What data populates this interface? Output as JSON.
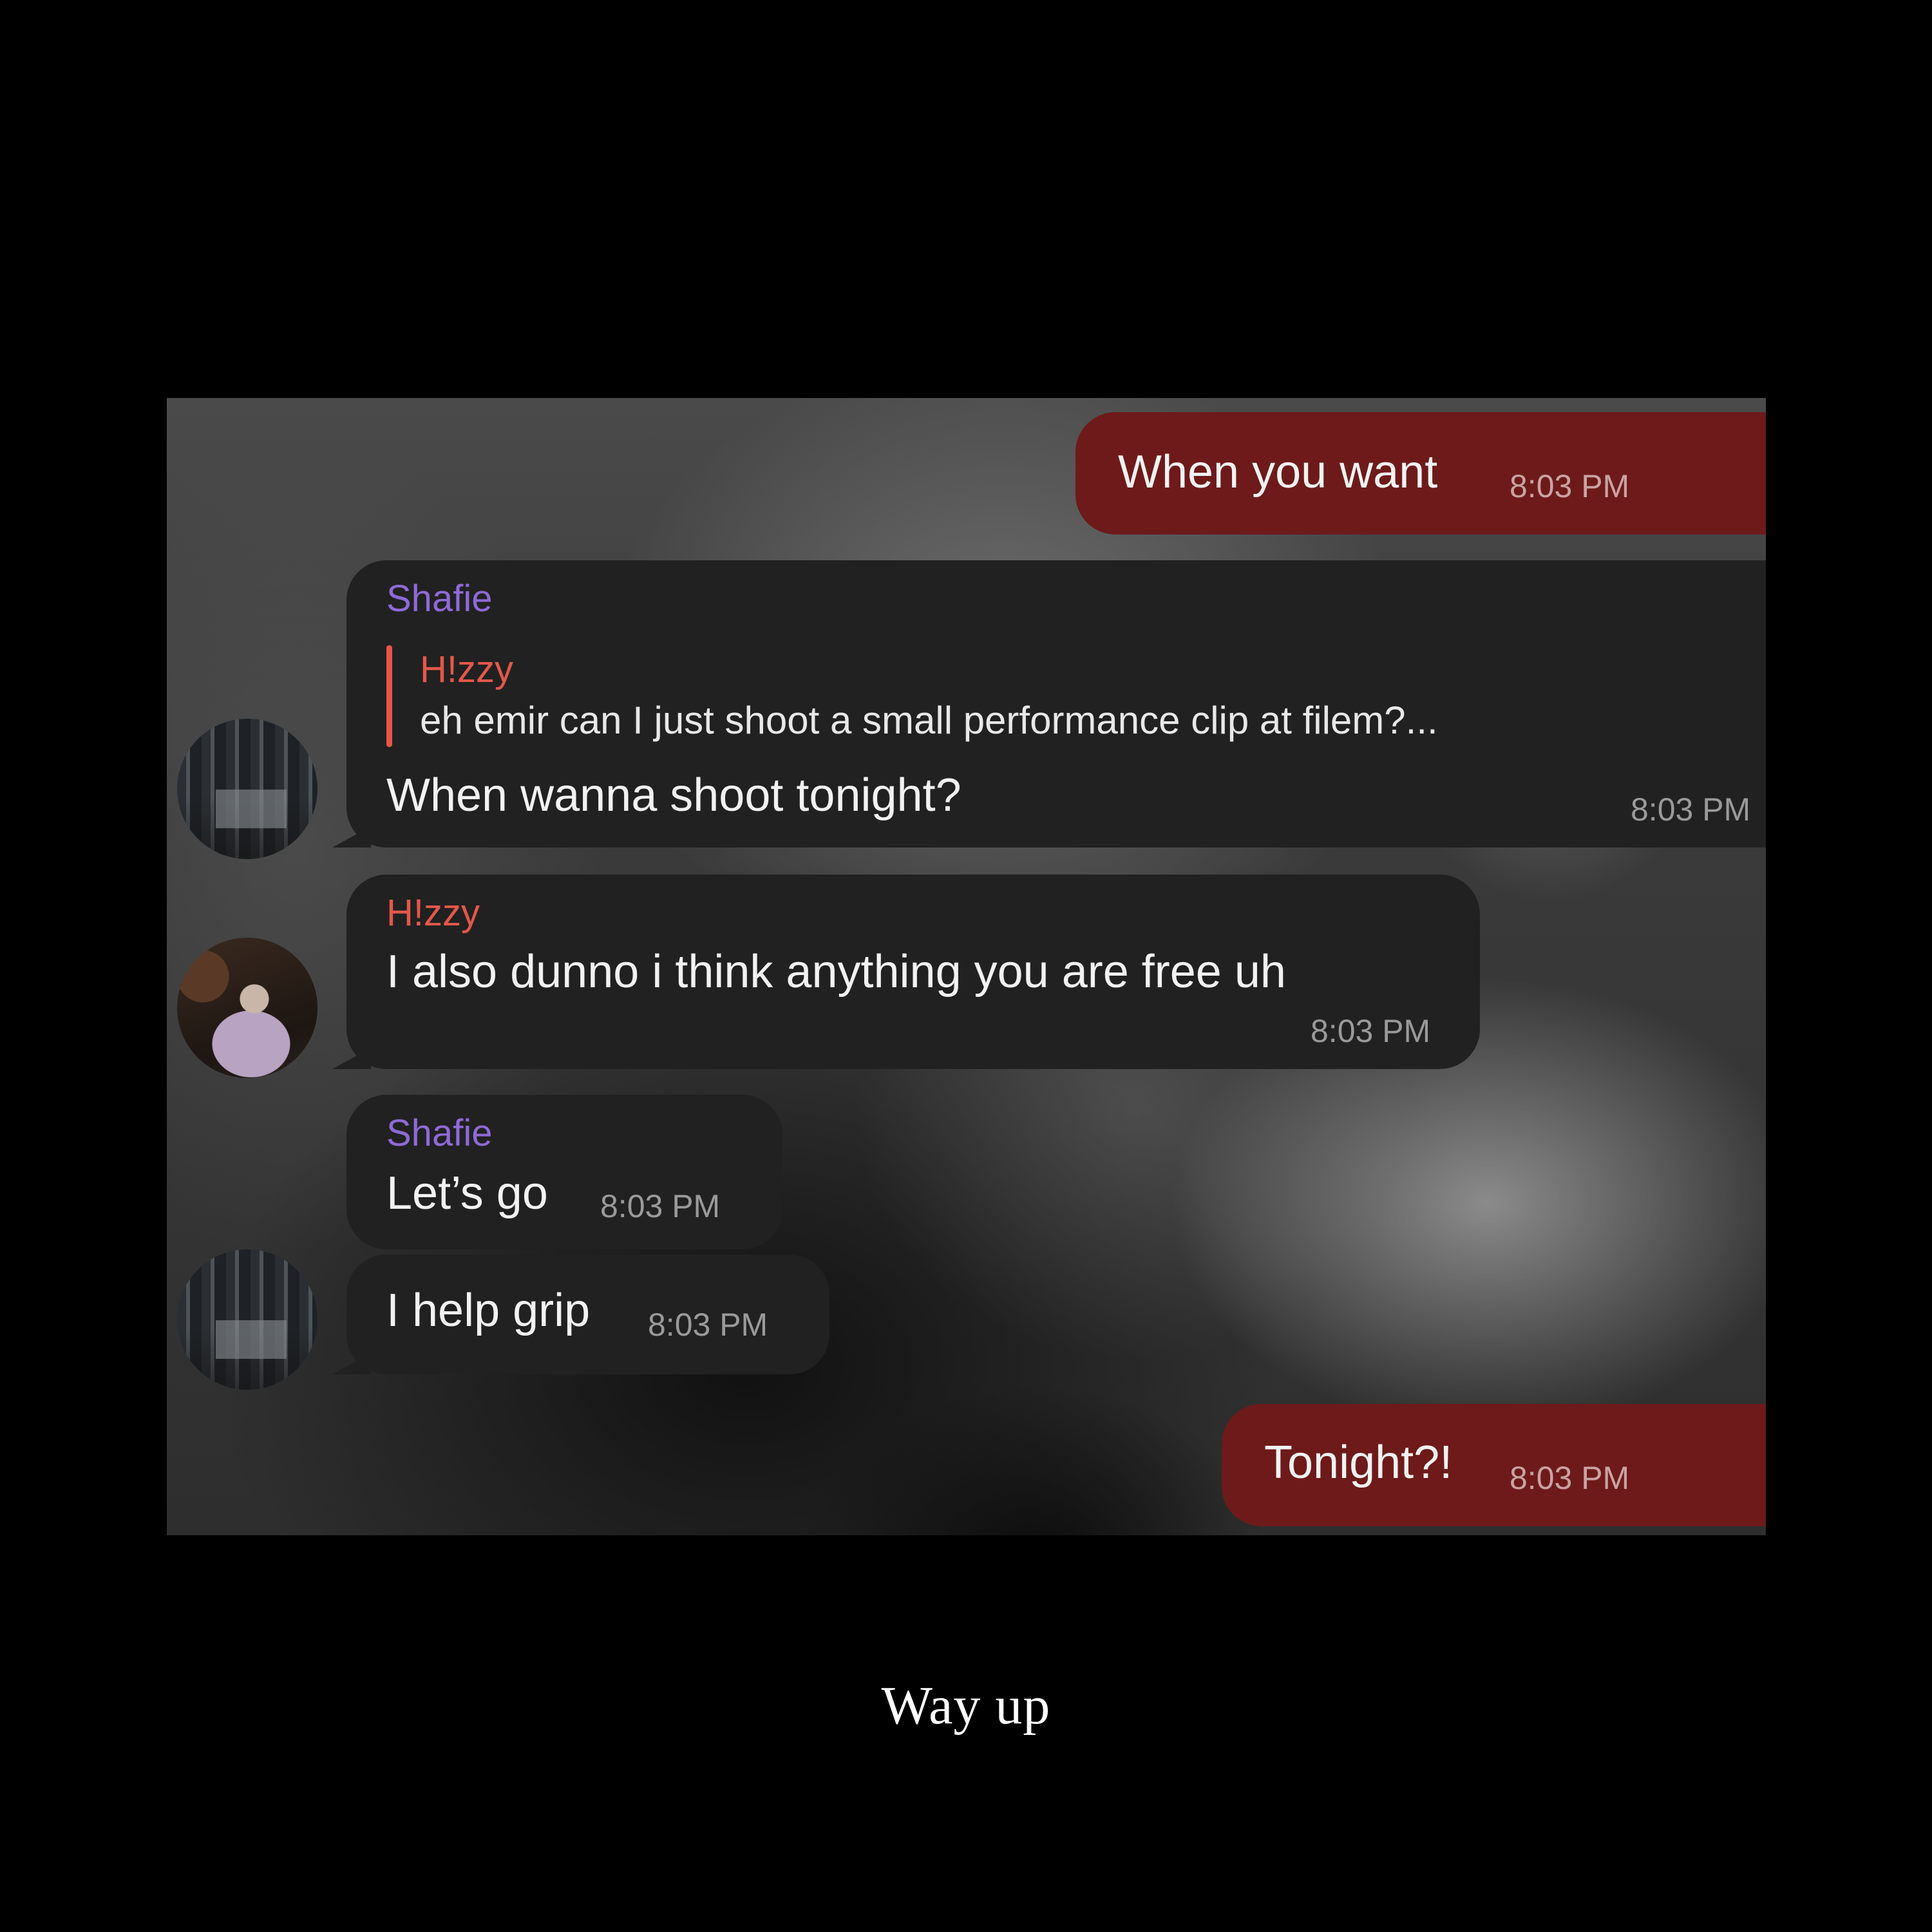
{
  "colors": {
    "outgoing_bubble": "#6e1a1a",
    "incoming_bubble": "#212121",
    "sender_shafie": "#8f6ad8",
    "sender_hizzy": "#e4574a",
    "timestamp": "#9a9a9a"
  },
  "messages": [
    {
      "direction": "outgoing",
      "text": "When you want",
      "time": "8:03 PM",
      "status_icon": "double-check-icon"
    },
    {
      "direction": "incoming",
      "sender": "Shafie",
      "reply_to": {
        "sender": "H!zzy",
        "text": "eh emir can I just shoot a small performance clip at filem?..."
      },
      "text": "When wanna shoot tonight?",
      "time": "8:03 PM"
    },
    {
      "direction": "incoming",
      "sender": "H!zzy",
      "text": "I also dunno i think anything you are free uh",
      "time": "8:03 PM"
    },
    {
      "direction": "incoming",
      "sender": "Shafie",
      "text": "Let’s go",
      "time": "8:03 PM"
    },
    {
      "direction": "incoming",
      "text": "I help grip",
      "time": "8:03 PM"
    },
    {
      "direction": "outgoing",
      "text": "Tonight?!",
      "time": "8:03 PM",
      "status_icon": "double-check-icon"
    }
  ],
  "caption": "Way up"
}
